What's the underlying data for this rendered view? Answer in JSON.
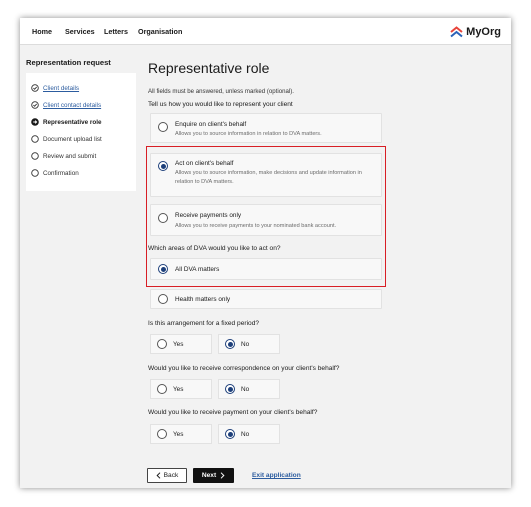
{
  "nav": {
    "home": "Home",
    "services": "Services",
    "letters": "Letters",
    "organisation": "Organisation",
    "logo_text": "MyOrg"
  },
  "sidebar": {
    "title": "Representation request",
    "items": [
      {
        "label": "Client details",
        "state": "complete"
      },
      {
        "label": "Client contact details",
        "state": "complete"
      },
      {
        "label": "Representative role",
        "state": "current"
      },
      {
        "label": "Document upload list",
        "state": "todo"
      },
      {
        "label": "Review and submit",
        "state": "todo"
      },
      {
        "label": "Confirmation",
        "state": "todo"
      }
    ]
  },
  "main": {
    "title": "Representative role",
    "hint": "All fields must be answered, unless marked (optional).",
    "q_represent": "Tell us how you would like to represent your client",
    "options": [
      {
        "label": "Enquire on client's behalf",
        "desc": "Allows you to source information in relation to DVA matters.",
        "checked": false
      },
      {
        "label": "Act on client's behalf",
        "desc": "Allows you to source information, make decisions and update information in relation to DVA matters.",
        "checked": true
      },
      {
        "label": "Receive payments only",
        "desc": "Allows you to receive payments to your nominated bank account.",
        "checked": false
      }
    ],
    "q_areas": "Which areas of DVA would you like to act on?",
    "areas": [
      {
        "label": "All DVA matters",
        "checked": true
      },
      {
        "label": "Health matters only",
        "checked": false
      }
    ],
    "q_fixed": "Is this arrangement for a fixed period?",
    "fixed_yes": "Yes",
    "fixed_no": "No",
    "fixed_value": "No",
    "q_correspondence": "Would you like to receive correspondence on your client's behalf?",
    "corr_yes": "Yes",
    "corr_no": "No",
    "corr_value": "No",
    "q_payment": "Would you like to receive payment on your client's behalf?",
    "pay_yes": "Yes",
    "pay_no": "No",
    "pay_value": "No"
  },
  "footer": {
    "back_label": "Back",
    "next_label": "Next",
    "exit_label": "Exit application"
  },
  "colors": {
    "accent": "#1d3f7a",
    "link": "#2c5c9f",
    "highlight": "#d81e25",
    "logo_top": "#e8443a",
    "logo_bottom": "#2b62b8"
  }
}
